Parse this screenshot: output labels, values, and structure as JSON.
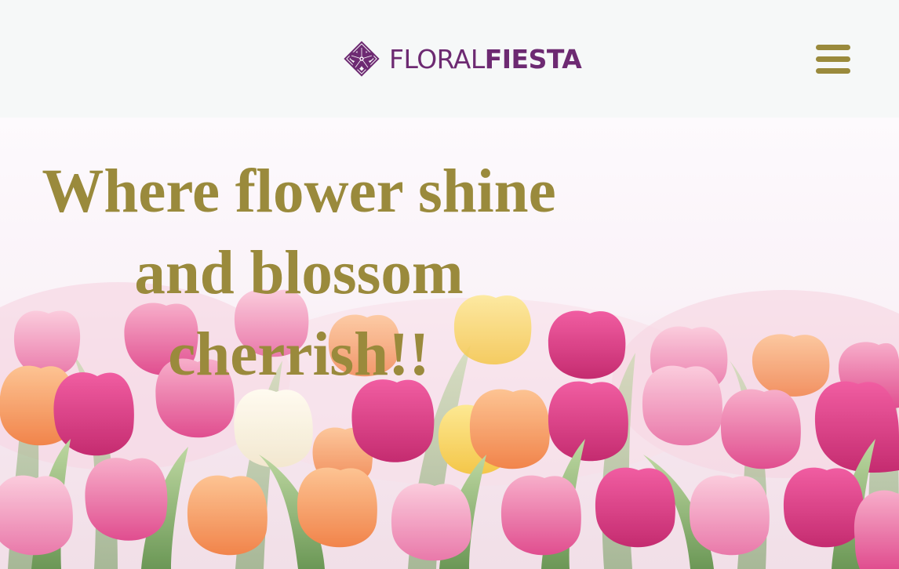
{
  "header": {
    "logo": {
      "name_part1": "FLORAL",
      "name_part2": "FIESTA",
      "icon": "hibiscus-diamond-icon",
      "color": "#6d2a72"
    },
    "menu_icon": "hamburger-menu-icon",
    "menu_color": "#9a8a3c",
    "background": "#f6f8f8"
  },
  "hero": {
    "image": "pink and orange tulips bouquet",
    "headline": "Where flower shine and blossom cherrish!!",
    "headline_color": "#9a8a3c"
  }
}
